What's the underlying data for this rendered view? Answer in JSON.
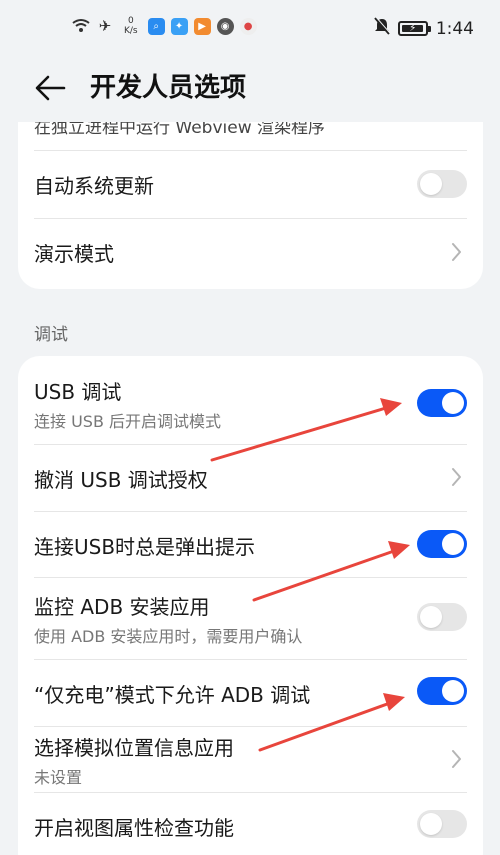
{
  "status_bar": {
    "speed_value": "0",
    "speed_unit": "K/s",
    "time": "1:44"
  },
  "header": {
    "title": "开发人员选项"
  },
  "card1": {
    "clipped_text": "在独立进程中运行 Webview 渲染程序",
    "rows": [
      {
        "title": "自动系统更新",
        "control": "toggle",
        "on": false
      },
      {
        "title": "演示模式",
        "control": "chevron"
      }
    ]
  },
  "section": {
    "label": "调试"
  },
  "card2": {
    "rows": [
      {
        "title": "USB 调试",
        "subtitle": "连接 USB 后开启调试模式",
        "control": "toggle",
        "on": true
      },
      {
        "title": "撤消 USB 调试授权",
        "control": "chevron"
      },
      {
        "title": "连接USB时总是弹出提示",
        "control": "toggle",
        "on": true
      },
      {
        "title": "监控 ADB 安装应用",
        "subtitle": "使用 ADB 安装应用时，需要用户确认",
        "control": "toggle",
        "on": false
      },
      {
        "title": "“仅充电”模式下允许 ADB 调试",
        "control": "toggle",
        "on": true
      },
      {
        "title": "选择模拟位置信息应用",
        "subtitle": "未设置",
        "control": "chevron"
      },
      {
        "title": "开启视图属性检查功能",
        "control": "toggle",
        "on": false
      }
    ]
  },
  "colors": {
    "accent": "#0a59f7",
    "annotation_arrow": "#e8453c",
    "background": "#f1f3f5"
  },
  "icons": [
    "wifi-icon",
    "airplane-icon",
    "search-app-icon",
    "lightbulb-app-icon",
    "video-app-icon",
    "camera-app-icon",
    "chrome-app-icon",
    "mute-icon",
    "battery-icon",
    "back-arrow-icon",
    "chevron-right-icon"
  ]
}
